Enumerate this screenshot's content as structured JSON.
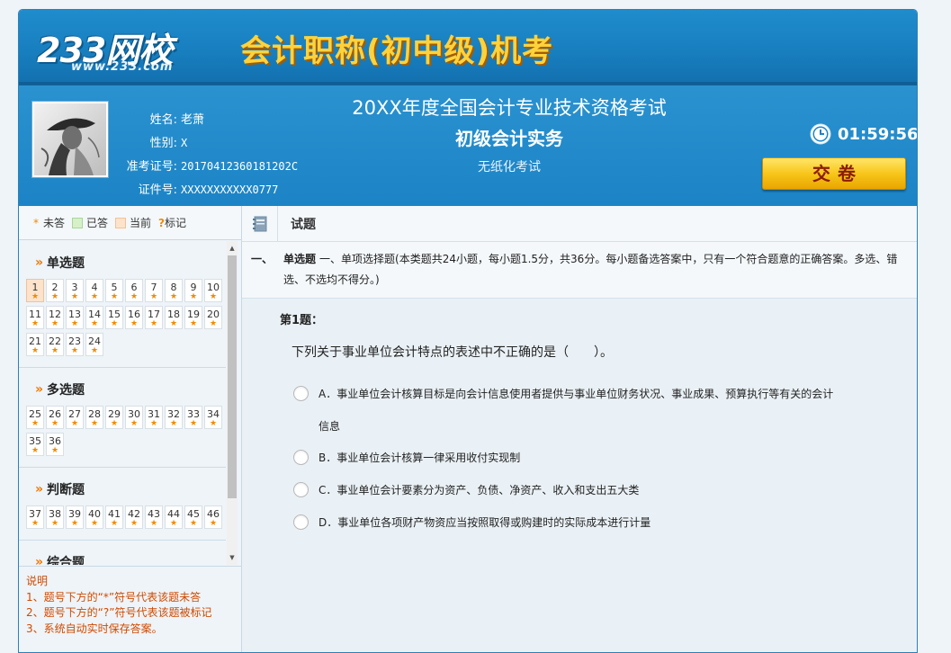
{
  "brand": {
    "logo_text": "233网校",
    "logo_url": "www.233.com",
    "exam_system_title": "会计职称(初中级)机考"
  },
  "candidate": {
    "name_label": "姓名:",
    "name_value": "老萧",
    "gender_label": "性别:",
    "gender_value": "X",
    "ticket_label": "准考证号:",
    "ticket_value": "20170412360181202C",
    "id_label": "证件号:",
    "id_value": "XXXXXXXXXXX0777"
  },
  "exam": {
    "name": "20XX年度全国会计专业技术资格考试",
    "subject": "初级会计实务",
    "type": "无纸化考试"
  },
  "timer": {
    "value": "01:59:56"
  },
  "submit_label": "交卷",
  "legend": {
    "unanswered": "未答",
    "answered": "已答",
    "current": "当前",
    "flagged": "标记"
  },
  "colors": {
    "brand_blue": "#1c84c6",
    "title_gold": "#ffd23c",
    "accent_orange": "#f08a00",
    "answered_green": "#d7f0c8",
    "current_peach": "#fde3cc"
  },
  "sections": [
    {
      "title": "单选题",
      "questions": [
        "1",
        "2",
        "3",
        "4",
        "5",
        "6",
        "7",
        "8",
        "9",
        "10",
        "11",
        "12",
        "13",
        "14",
        "15",
        "16",
        "17",
        "18",
        "19",
        "20",
        "21",
        "22",
        "23",
        "24"
      ]
    },
    {
      "title": "多选题",
      "questions": [
        "25",
        "26",
        "27",
        "28",
        "29",
        "30",
        "31",
        "32",
        "33",
        "34",
        "35",
        "36"
      ]
    },
    {
      "title": "判断题",
      "questions": [
        "37",
        "38",
        "39",
        "40",
        "41",
        "42",
        "43",
        "44",
        "45",
        "46"
      ]
    },
    {
      "title": "综合题",
      "questions": []
    }
  ],
  "current_question": "1",
  "notes": {
    "title": "说明",
    "lines": [
      "1、题号下方的“*”符号代表该题未答",
      "2、题号下方的“?”符号代表该题被标记",
      "3、系统自动实时保存答案。"
    ]
  },
  "main": {
    "header": "试题",
    "section_index": "一、",
    "section_name": "单选题",
    "section_desc": "一、单项选择题(本类题共24小题，每小题1.5分，共36分。每小题备选答案中，只有一个符合题意的正确答案。多选、错选、不选均不得分。)",
    "question_label": "第1题：",
    "stem": "下列关于事业单位会计特点的表述中不正确的是（　　）。",
    "options": [
      {
        "key": "A",
        "text": "A．事业单位会计核算目标是向会计信息使用者提供与事业单位财务状况、事业成果、预算执行等有关的会计信息"
      },
      {
        "key": "B",
        "text": "B．事业单位会计核算一律采用收付实现制"
      },
      {
        "key": "C",
        "text": "C．事业单位会计要素分为资产、负债、净资产、收入和支出五大类"
      },
      {
        "key": "D",
        "text": "D．事业单位各项财产物资应当按照取得或购建时的实际成本进行计量"
      }
    ]
  }
}
